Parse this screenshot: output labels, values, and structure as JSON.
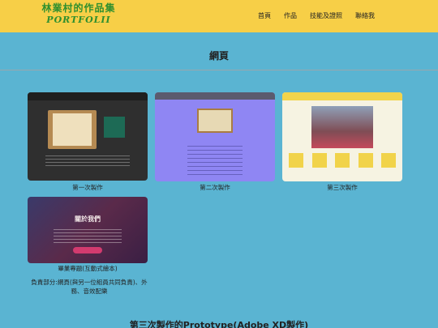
{
  "header": {
    "logo_title": "林業村的作品集",
    "logo_subtitle": "PORTFOLII",
    "nav": [
      "首頁",
      "作品",
      "技能及證照",
      "聯絡我"
    ]
  },
  "section": {
    "title": "網頁"
  },
  "works": [
    {
      "caption": "第一次製作"
    },
    {
      "caption": "第二次製作"
    },
    {
      "caption": "第三次製作"
    },
    {
      "caption": "畢業專題(互動式繪本)",
      "note": "負責部分:網頁(與另一位組員共同負責)、外務、音效配樂"
    }
  ],
  "bottom_title": "第三次製作的Prototype(Adobe XD製作)",
  "colors": {
    "header_bg": "#f7cf47",
    "page_bg": "#5ab4d2",
    "logo_green": "#2e8f2e"
  }
}
